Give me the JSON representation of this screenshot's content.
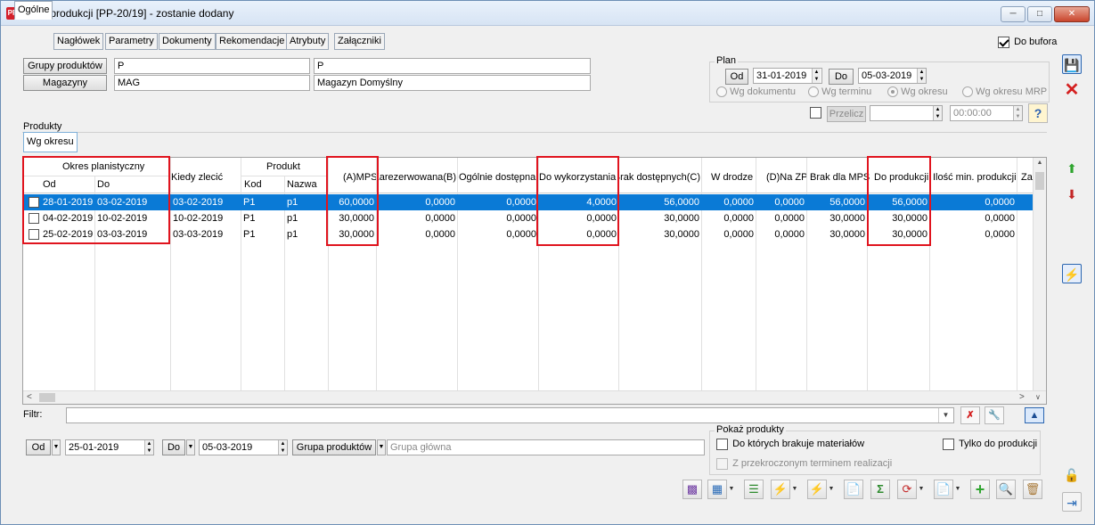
{
  "window": {
    "title": "Plan produkcji [PP-20/19] - zostanie dodany",
    "app_icon_text": "PP"
  },
  "tabs": [
    {
      "label": "Ogólne",
      "active": true
    },
    {
      "label": "Nagłówek"
    },
    {
      "label": "Parametry"
    },
    {
      "label": "Dokumenty"
    },
    {
      "label": "Rekomendacje"
    },
    {
      "label": "Atrybuty"
    },
    {
      "label": "Załączniki"
    }
  ],
  "do_bufora": {
    "label": "Do bufora",
    "checked": true
  },
  "header": {
    "grupy_button": "Grupy produktów",
    "grupy_code": "P",
    "grupy_name": "P",
    "magazyny_button": "Magazyny",
    "magazyn_code": "MAG",
    "magazyn_name": "Magazyn Domyślny"
  },
  "plan": {
    "title": "Plan",
    "od_label": "Od",
    "od_value": "31-01-2019",
    "do_label": "Do",
    "do_value": "05-03-2019",
    "radio_wg_dokumentu": "Wg dokumentu",
    "radio_wg_terminu": "Wg terminu",
    "radio_wg_okresu": "Wg okresu",
    "radio_wg_okresu_mrp": "Wg okresu MRP",
    "przelicz_label": "Przelicz",
    "time_value": "00:00:00"
  },
  "produkty": {
    "label": "Produkty",
    "subtab": "Wg okresu"
  },
  "grid": {
    "group_okres": "Okres planistyczny",
    "col_od": "Od",
    "col_do": "Do",
    "col_kiedy": "Kiedy zlecić",
    "group_produkt": "Produkt",
    "col_kod": "Kod",
    "col_nazwa": "Nazwa",
    "col_mps": "(A)MPS",
    "col_zarezerwowana": "(B)Zarezerwowana",
    "col_ogolnie": "Ogólnie dostępna",
    "col_do_wykorzystania": "Do wykorzystania",
    "col_brak_dostepnych": "(C)Brak dostępnych",
    "col_w_drodze": "W drodze",
    "col_na_zp": "(D)Na ZP",
    "col_brak_mps": "Brak dla MPS",
    "col_do_produkcji": "Do produkcji",
    "col_ilosc_min": "Ilość min. produkcji",
    "col_extra": "Zap",
    "rows": [
      {
        "od": "28-01-2019",
        "do": "03-02-2019",
        "kiedy": "03-02-2019",
        "kod": "P1",
        "nazwa": "p1",
        "mps": "60,0000",
        "zarezerwowana": "0,0000",
        "ogolnie": "0,0000",
        "do_wykorzystania": "4,0000",
        "brak_dostepnych": "56,0000",
        "w_drodze": "0,0000",
        "na_zp": "0,0000",
        "brak_mps": "56,0000",
        "do_produkcji": "56,0000",
        "ilosc_min": "0,0000"
      },
      {
        "od": "04-02-2019",
        "do": "10-02-2019",
        "kiedy": "10-02-2019",
        "kod": "P1",
        "nazwa": "p1",
        "mps": "30,0000",
        "zarezerwowana": "0,0000",
        "ogolnie": "0,0000",
        "do_wykorzystania": "0,0000",
        "brak_dostepnych": "30,0000",
        "w_drodze": "0,0000",
        "na_zp": "0,0000",
        "brak_mps": "30,0000",
        "do_produkcji": "30,0000",
        "ilosc_min": "0,0000"
      },
      {
        "od": "25-02-2019",
        "do": "03-03-2019",
        "kiedy": "03-03-2019",
        "kod": "P1",
        "nazwa": "p1",
        "mps": "30,0000",
        "zarezerwowana": "0,0000",
        "ogolnie": "0,0000",
        "do_wykorzystania": "0,0000",
        "brak_dostepnych": "30,0000",
        "w_drodze": "0,0000",
        "na_zp": "0,0000",
        "brak_mps": "30,0000",
        "do_produkcji": "30,0000",
        "ilosc_min": "0,0000"
      }
    ]
  },
  "filter": {
    "label": "Filtr:",
    "value": ""
  },
  "bottom": {
    "od_label": "Od",
    "od_value": "25-01-2019",
    "do_label": "Do",
    "do_value": "05-03-2019",
    "grupa_button": "Grupa produktów",
    "grupa_value": "Grupa główna"
  },
  "pokaz": {
    "title": "Pokaż produkty",
    "brakuje": "Do których brakuje materiałów",
    "tylko": "Tylko do produkcji",
    "przekroczonym": "Z przekroczonym terminem realizacji"
  },
  "icons": {
    "save": "save-icon",
    "cancel": "cancel-icon",
    "highlight_color": "#e0141e",
    "selection_color": "#0a7ad6"
  }
}
